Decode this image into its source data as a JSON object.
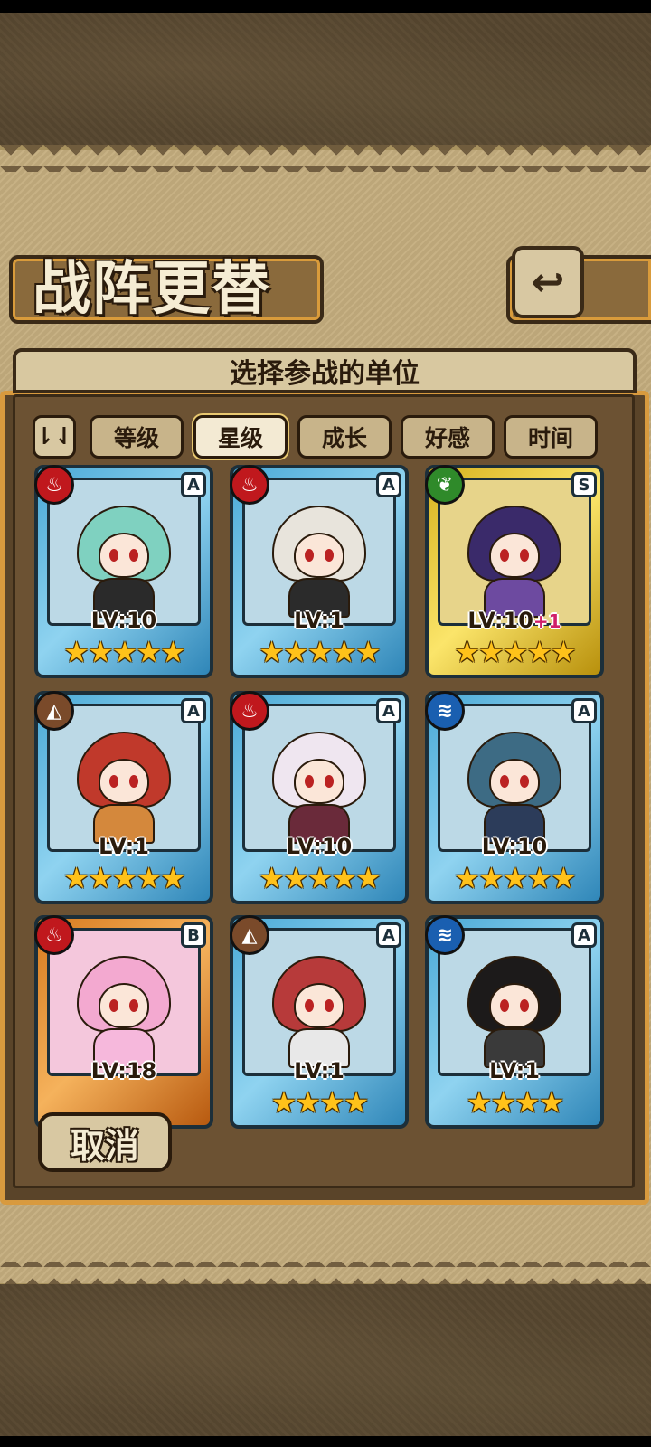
{
  "header": {
    "title": "战阵更替",
    "back_icon": "back-arrow-icon"
  },
  "panel": {
    "subtitle": "选择参战的单位"
  },
  "sort": {
    "toggle_label": "⇂⇃"
  },
  "tabs": [
    {
      "label": "等级",
      "active": false
    },
    {
      "label": "星级",
      "active": true
    },
    {
      "label": "成长",
      "active": false
    },
    {
      "label": "好感",
      "active": false
    },
    {
      "label": "时间",
      "active": false
    }
  ],
  "units": [
    {
      "element": "fire",
      "element_glyph": "♨",
      "rank": "A",
      "level": "LV:10",
      "level_bonus": "",
      "stars": "★★★★★",
      "frame": "blue"
    },
    {
      "element": "fire",
      "element_glyph": "♨",
      "rank": "A",
      "level": "LV:1",
      "level_bonus": "",
      "stars": "★★★★★",
      "frame": "blue"
    },
    {
      "element": "wood",
      "element_glyph": "❦",
      "rank": "S",
      "level": "LV:10",
      "level_bonus": "+1",
      "stars": "★★★★★",
      "frame": "gold"
    },
    {
      "element": "earth",
      "element_glyph": "◭",
      "rank": "A",
      "level": "LV:1",
      "level_bonus": "",
      "stars": "★★★★★",
      "frame": "blue"
    },
    {
      "element": "fire",
      "element_glyph": "♨",
      "rank": "A",
      "level": "LV:10",
      "level_bonus": "",
      "stars": "★★★★★",
      "frame": "blue"
    },
    {
      "element": "water",
      "element_glyph": "≋",
      "rank": "A",
      "level": "LV:10",
      "level_bonus": "",
      "stars": "★★★★★",
      "frame": "blue"
    },
    {
      "element": "fire",
      "element_glyph": "♨",
      "rank": "B",
      "level": "LV:18",
      "level_bonus": "",
      "stars": "",
      "frame": "bronze"
    },
    {
      "element": "earth",
      "element_glyph": "◭",
      "rank": "A",
      "level": "LV:1",
      "level_bonus": "",
      "stars": "★★★★",
      "frame": "blue"
    },
    {
      "element": "water",
      "element_glyph": "≋",
      "rank": "A",
      "level": "LV:1",
      "level_bonus": "",
      "stars": "★★★★",
      "frame": "blue"
    }
  ],
  "footer": {
    "cancel_label": "取消"
  },
  "colors": {
    "fire": "#c0181d",
    "wood": "#2f8a2a",
    "earth": "#7a4a2a",
    "water": "#1a5fb0",
    "accent": "#d89a3e"
  }
}
